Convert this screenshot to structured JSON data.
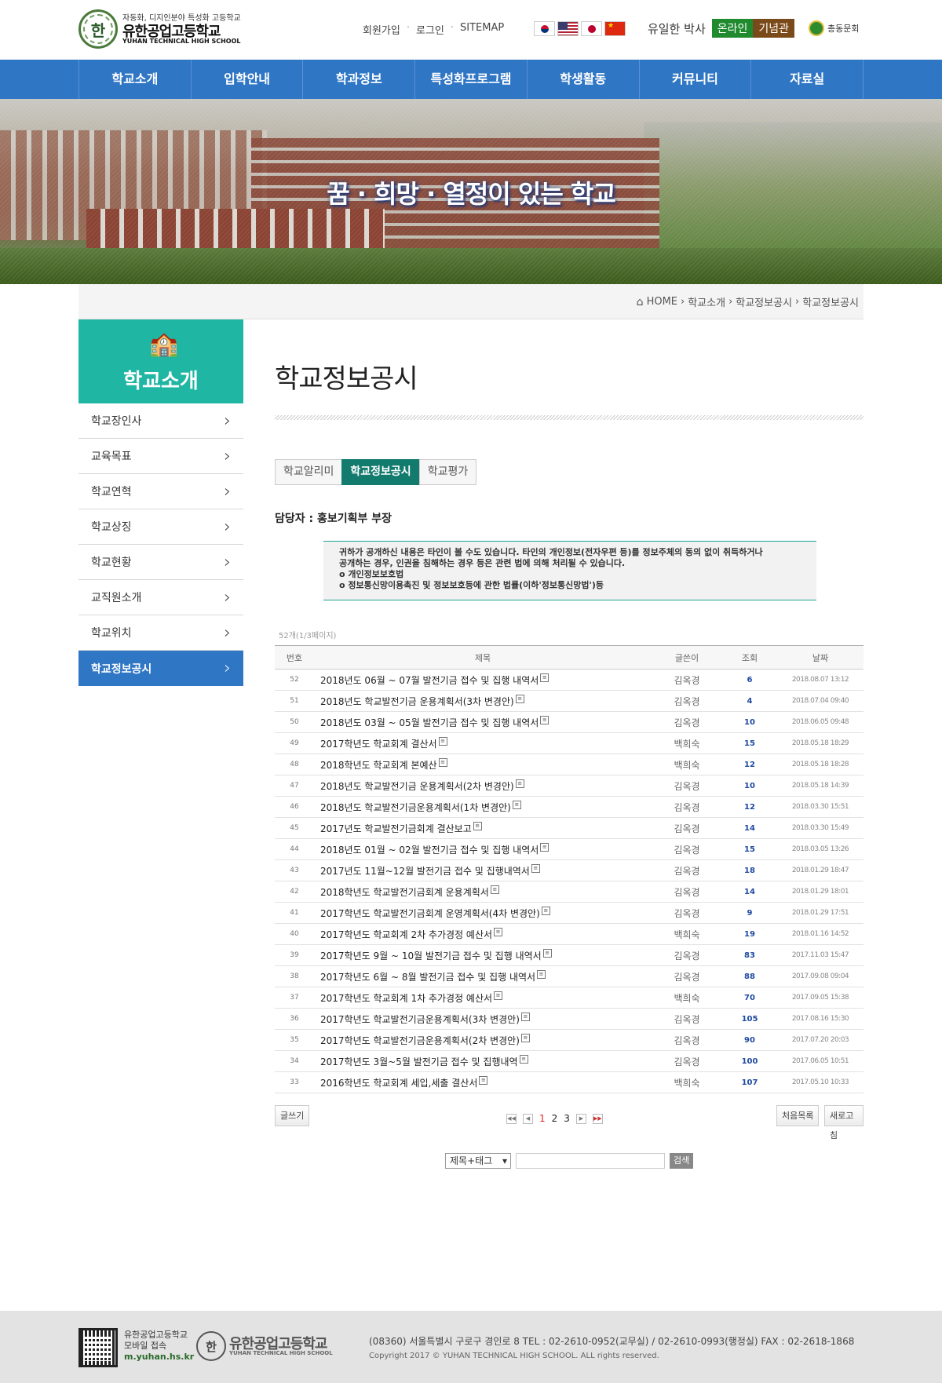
{
  "header": {
    "logo_sub": "자동화, 디지인분야 특성화 고등학교",
    "logo_name": "유한공업고등학교",
    "logo_eng": "YUHAN TECHNICAL HIGH SCHOOL",
    "logo_mark": "한",
    "links": [
      "회원가입",
      "로그인",
      "SITEMAP"
    ],
    "online_prefix": "유일한 박사",
    "online_badge1": "온라인",
    "online_badge2": "기념관",
    "alumni": "총동문회"
  },
  "nav": [
    "학교소개",
    "입학안내",
    "학과정보",
    "특성화프로그램",
    "학생활동",
    "커뮤니티",
    "자료실"
  ],
  "banner": {
    "slogan": "꿈 · 희망 · 열정이 있는 학교"
  },
  "breadcrumb": {
    "home": "HOME",
    "items": [
      "학교소개",
      "학교정보공시",
      "학교정보공시"
    ]
  },
  "sidebar": {
    "title": "학교소개",
    "items": [
      "학교장인사",
      "교육목표",
      "학교연혁",
      "학교상징",
      "학교현황",
      "교직원소개",
      "학교위치",
      "학교정보공시"
    ],
    "active_index": 7
  },
  "main": {
    "title": "학교정보공시",
    "subtabs": [
      "학교알리미",
      "학교정보공시",
      "학교평가"
    ],
    "active_tab": 1,
    "manager": "담당자 : 홍보기획부 부장",
    "notice": [
      "귀하가 공개하신 내용은 타인이 볼 수도 있습니다. 타인의 개인정보(전자우편 등)를 정보주체의 동의 없이 취득하거나",
      "공개하는 경우, 인권을 침해하는 경우 등은 관련 법에 의해 처리될 수 있습니다.",
      "o 개인정보보호법",
      "o 정보통신망이용촉진 및 정보보호등에 관한 법률(이하'정보통신망법')등"
    ],
    "count": "52개(1/3페이지)"
  },
  "board": {
    "columns": [
      "번호",
      "제목",
      "글쓴이",
      "조회",
      "날짜"
    ],
    "rows": [
      {
        "no": "52",
        "title": "2018년도 06월 ~ 07월 발전기금 접수 및 집행 내역서",
        "writer": "김옥경",
        "hits": "6",
        "date": "2018.08.07 13:12"
      },
      {
        "no": "51",
        "title": "2018년도 학교발전기금 운용계획서(3차 변경안)",
        "writer": "김옥경",
        "hits": "4",
        "date": "2018.07.04 09:40"
      },
      {
        "no": "50",
        "title": "2018년도 03월 ~ 05월 발전기금 접수 및 집행 내역서",
        "writer": "김옥경",
        "hits": "10",
        "date": "2018.06.05 09:48"
      },
      {
        "no": "49",
        "title": "2017학년도 학교회계 결산서",
        "writer": "백희숙",
        "hits": "15",
        "date": "2018.05.18 18:29"
      },
      {
        "no": "48",
        "title": "2018학년도 학교회계 본예산",
        "writer": "백희숙",
        "hits": "12",
        "date": "2018.05.18 18:28"
      },
      {
        "no": "47",
        "title": "2018년도 학교발전기금 운용계획서(2차 변경안)",
        "writer": "김옥경",
        "hits": "10",
        "date": "2018.05.18 14:39"
      },
      {
        "no": "46",
        "title": "2018년도 학교발전기금운용계획서(1차 변경안)",
        "writer": "김옥경",
        "hits": "12",
        "date": "2018.03.30 15:51"
      },
      {
        "no": "45",
        "title": "2017년도 학교발전기금회계 결산보고",
        "writer": "김옥경",
        "hits": "14",
        "date": "2018.03.30 15:49"
      },
      {
        "no": "44",
        "title": "2018년도 01월 ~ 02월 발전기금 접수 및 집행 내역서",
        "writer": "김옥경",
        "hits": "15",
        "date": "2018.03.05 13:26"
      },
      {
        "no": "43",
        "title": "2017년도 11월~12월 발전기금 접수 및 집행내역서",
        "writer": "김옥경",
        "hits": "18",
        "date": "2018.01.29 18:47"
      },
      {
        "no": "42",
        "title": "2018학년도 학교발전기금회계 운용계획서",
        "writer": "김옥경",
        "hits": "14",
        "date": "2018.01.29 18:01"
      },
      {
        "no": "41",
        "title": "2017학년도 학교발전기금회계 운영계획서(4차 변경안)",
        "writer": "김옥경",
        "hits": "9",
        "date": "2018.01.29 17:51"
      },
      {
        "no": "40",
        "title": "2017학년도 학교회계 2차 추가경정 예산서",
        "writer": "백희숙",
        "hits": "19",
        "date": "2018.01.16 14:52"
      },
      {
        "no": "39",
        "title": "2017학년도 9월 ~ 10월 발전기금 접수 및 집행 내역서",
        "writer": "김옥경",
        "hits": "83",
        "date": "2017.11.03 15:47"
      },
      {
        "no": "38",
        "title": "2017학년도 6월 ~ 8월 발전기금 접수 및 집행 내역서",
        "writer": "김옥경",
        "hits": "88",
        "date": "2017.09.08 09:04"
      },
      {
        "no": "37",
        "title": "2017학년도 학교회계 1차 추가경정 예산서",
        "writer": "백희숙",
        "hits": "70",
        "date": "2017.09.05 15:38"
      },
      {
        "no": "36",
        "title": "2017학년도 학교발전기금운용계획서(3차 변경안)",
        "writer": "김옥경",
        "hits": "105",
        "date": "2017.08.16 15:30"
      },
      {
        "no": "35",
        "title": "2017학년도 학교발전기금운용계획서(2차 변경안)",
        "writer": "김옥경",
        "hits": "90",
        "date": "2017.07.20 20:03"
      },
      {
        "no": "34",
        "title": "2017학년도 3월~5월 발전기금 접수 및 집행내역",
        "writer": "김옥경",
        "hits": "100",
        "date": "2017.06.05 10:51"
      },
      {
        "no": "33",
        "title": "2016학년도 학교회계 세입,세출 결산서",
        "writer": "백희숙",
        "hits": "107",
        "date": "2017.05.10 10:33"
      }
    ]
  },
  "controls": {
    "write": "글쓰기",
    "list": "처음목록",
    "refresh": "새로고침",
    "pages": [
      "1",
      "2",
      "3"
    ],
    "current_page": "1"
  },
  "search": {
    "select": "제목+태그",
    "button": "검색"
  },
  "footer": {
    "mobile_title": "유한공업고등학교",
    "mobile_sub": "모바일 접속",
    "mobile_url": "m.yuhan.hs.kr",
    "logo_name": "유한공업고등학교",
    "logo_eng": "YUHAN TECHNICAL HIGH SCHOOL",
    "logo_mark": "한",
    "address": "(08360) 서울특별시 구로구 경인로 8   TEL : 02-2610-0952(교무실) / 02-2610-0993(행정실)   FAX : 02-2618-1868",
    "copyright": "Copyright 2017 © YUHAN TECHNICAL HIGH SCHOOL. ALL rights reserved."
  }
}
